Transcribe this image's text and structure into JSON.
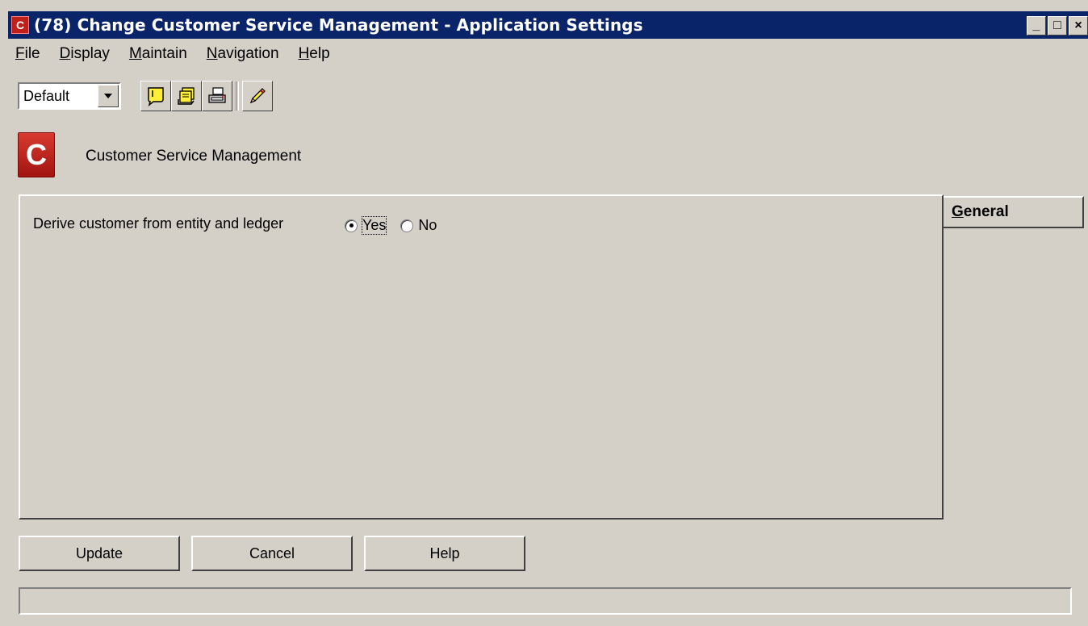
{
  "window": {
    "title": "(78) Change Customer Service Management - Application Settings",
    "controls": {
      "minimize": "_",
      "maximize": "□",
      "close": "×"
    }
  },
  "menu": [
    {
      "label": "File",
      "mnemonic": "F",
      "rest": "ile"
    },
    {
      "label": "Display",
      "mnemonic": "D",
      "rest": "isplay"
    },
    {
      "label": "Maintain",
      "mnemonic": "M",
      "rest": "aintain"
    },
    {
      "label": "Navigation",
      "mnemonic": "N",
      "rest": "avigation"
    },
    {
      "label": "Help",
      "mnemonic": "H",
      "rest": "elp"
    }
  ],
  "toolbar": {
    "view_select": "Default",
    "icons": [
      "note-icon",
      "stack-icon",
      "print-icon",
      "edit-pencil-icon"
    ]
  },
  "module": {
    "title": "Customer Service Management"
  },
  "form": {
    "derive_label": "Derive customer from entity and ledger",
    "options": [
      "Yes",
      "No"
    ],
    "selected": "Yes"
  },
  "tabs": [
    {
      "label": "General",
      "mnemonic": "G",
      "rest": "eneral",
      "active": true
    }
  ],
  "buttons": {
    "update": "Update",
    "cancel": "Cancel",
    "help": "Help"
  },
  "status": "",
  "colors": {
    "titlebar": "#0a246a",
    "face": "#d4d0c8",
    "brand_red": "#c0201a"
  }
}
